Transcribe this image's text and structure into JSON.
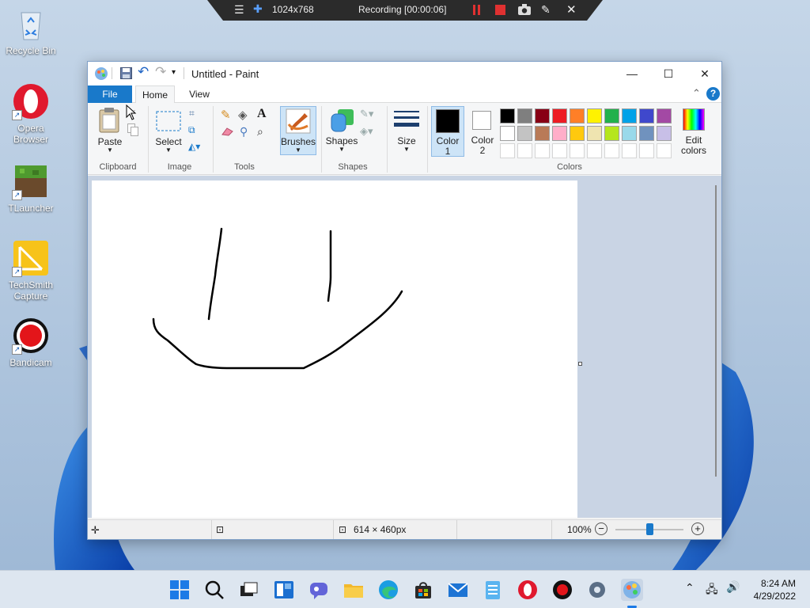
{
  "desktop": {
    "icons": [
      {
        "label": "Recycle Bin"
      },
      {
        "label": "Opera Browser"
      },
      {
        "label": "TLauncher"
      },
      {
        "label": "TechSmith Capture"
      },
      {
        "label": "Bandicam"
      }
    ]
  },
  "recording_bar": {
    "resolution": "1024x768",
    "status": "Recording [00:00:06]",
    "colors": {
      "pause": "#e03131",
      "stop": "#e03131"
    }
  },
  "window": {
    "title": "Untitled - Paint",
    "icons": [
      "paint-app-icon",
      "save-icon",
      "undo-icon",
      "redo-icon",
      "customize-arrow-icon"
    ]
  },
  "tabs": {
    "file": "File",
    "home": "Home",
    "view": "View"
  },
  "ribbon": {
    "paste": "Paste",
    "select": "Select",
    "brushes": "Brushes",
    "shapes": "Shapes",
    "size": "Size",
    "color1_line1": "Color",
    "color1_line2": "1",
    "color2_line1": "Color",
    "color2_line2": "2",
    "edit_colors_line1": "Edit",
    "edit_colors_line2": "colors",
    "groups": {
      "clipboard": "Clipboard",
      "image": "Image",
      "tools": "Tools",
      "shapes": "Shapes",
      "colors": "Colors"
    },
    "palette_row1": [
      "#000000",
      "#7f7f7f",
      "#880015",
      "#ed1c24",
      "#ff7f27",
      "#fff200",
      "#22b14c",
      "#00a2e8",
      "#3f48cc",
      "#a349a4"
    ],
    "palette_row2": [
      "#ffffff",
      "#c3c3c3",
      "#b97a57",
      "#ffaec9",
      "#ffc90e",
      "#efe4b0",
      "#b5e61d",
      "#99d9ea",
      "#7092be",
      "#c8bfe7"
    ],
    "color1": "#000000",
    "color2": "#ffffff"
  },
  "status": {
    "canvas_size": "614 × 460px",
    "zoom": "100%"
  },
  "taskbar": {
    "time": "8:24 AM",
    "date": "4/29/2022",
    "apps": [
      "start-icon",
      "search-icon",
      "task-view-icon",
      "widgets-icon",
      "chat-icon",
      "file-explorer-icon",
      "edge-icon",
      "store-icon",
      "mail-icon",
      "notepad-icon",
      "opera-icon",
      "bandicam-icon",
      "settings-icon",
      "paint-icon"
    ]
  }
}
